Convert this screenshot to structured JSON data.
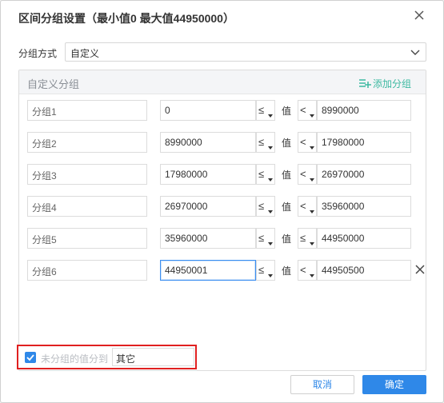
{
  "dialog": {
    "title": "区间分组设置（最小值0 最大值44950000）",
    "method_label": "分组方式",
    "method_value": "自定义"
  },
  "panel": {
    "title": "自定义分组",
    "add_label": "添加分组"
  },
  "value_label": "值",
  "groups": [
    {
      "name": "分组1",
      "low": "0",
      "low_op": "≤",
      "high_op": "<",
      "high": "8990000"
    },
    {
      "name": "分组2",
      "low": "8990000",
      "low_op": "≤",
      "high_op": "<",
      "high": "17980000"
    },
    {
      "name": "分组3",
      "low": "17980000",
      "low_op": "≤",
      "high_op": "<",
      "high": "26970000"
    },
    {
      "name": "分组4",
      "low": "26970000",
      "low_op": "≤",
      "high_op": "<",
      "high": "35960000"
    },
    {
      "name": "分组5",
      "low": "35960000",
      "low_op": "≤",
      "high_op": "≤",
      "high": "44950000"
    },
    {
      "name": "分组6",
      "low": "44950001",
      "low_op": "≤",
      "high_op": "<",
      "high": "44950500"
    }
  ],
  "ungrouped": {
    "checked": true,
    "label": "未分组的值分到",
    "value": "其它"
  },
  "buttons": {
    "cancel": "取消",
    "ok": "确定"
  },
  "colors": {
    "accent": "#2f88e8",
    "add_green": "#3db9a1",
    "highlight_border": "#e02020"
  }
}
